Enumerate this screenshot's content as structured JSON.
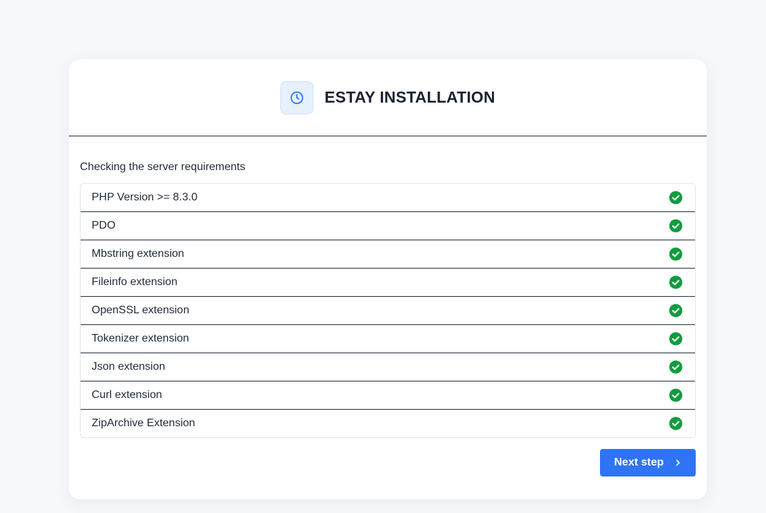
{
  "header": {
    "title": "ESTAY INSTALLATION",
    "logo_icon": "clock-icon"
  },
  "body": {
    "subtitle": "Checking the server requirements",
    "requirements": [
      {
        "label": "PHP Version >= 8.3.0",
        "status": "passed",
        "icon": "check-circle-icon"
      },
      {
        "label": "PDO",
        "status": "passed",
        "icon": "check-circle-icon"
      },
      {
        "label": "Mbstring extension",
        "status": "passed",
        "icon": "check-circle-icon"
      },
      {
        "label": "Fileinfo extension",
        "status": "passed",
        "icon": "check-circle-icon"
      },
      {
        "label": "OpenSSL extension",
        "status": "passed",
        "icon": "check-circle-icon"
      },
      {
        "label": "Tokenizer extension",
        "status": "passed",
        "icon": "check-circle-icon"
      },
      {
        "label": "Json extension",
        "status": "passed",
        "icon": "check-circle-icon"
      },
      {
        "label": "Curl extension",
        "status": "passed",
        "icon": "check-circle-icon"
      },
      {
        "label": "ZipArchive Extension",
        "status": "passed",
        "icon": "check-circle-icon"
      }
    ]
  },
  "footer": {
    "next_label": "Next step",
    "next_icon": "chevron-right-icon"
  },
  "colors": {
    "accent": "#2f74f5",
    "success": "#0f9d3e",
    "background": "#f6f8fc"
  }
}
